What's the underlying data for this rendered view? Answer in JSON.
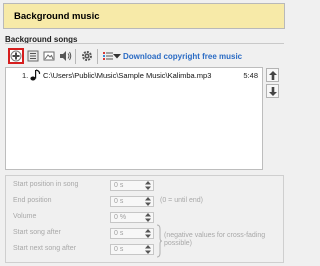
{
  "panel": {
    "title": "Background music"
  },
  "section": {
    "label": "Background songs"
  },
  "toolbar": {
    "buttons": [
      {
        "name": "add-song-button",
        "icon": "plus-icon"
      },
      {
        "name": "list-view-button",
        "icon": "list-icon"
      },
      {
        "name": "image-button",
        "icon": "image-icon"
      },
      {
        "name": "volume-button",
        "icon": "speaker-icon"
      },
      {
        "name": "settings-button",
        "icon": "gear-icon"
      },
      {
        "name": "list-options-button",
        "icon": "list-color-icon"
      },
      {
        "name": "dropdown-button",
        "icon": "chevron-down-icon"
      }
    ],
    "link_text": "Download copyright free music"
  },
  "songs": [
    {
      "index": "1.",
      "path": "C:\\Users\\Public\\Music\\Sample Music\\Kalimba.mp3",
      "duration": "5:48"
    }
  ],
  "properties": {
    "start_position": {
      "label": "Start position in song",
      "value": "0 s"
    },
    "end_position": {
      "label": "End position",
      "value": "0 s",
      "note": "(0 = until end)"
    },
    "volume": {
      "label": "Volume",
      "value": "0 %"
    },
    "start_song_after": {
      "label": "Start song after",
      "value": "0 s"
    },
    "start_next_song_after": {
      "label": "Start next song after",
      "value": "0 s"
    },
    "cross_fading_note_line1": "(negative values for cross-fading",
    "cross_fading_note_line2": "possible)"
  },
  "colors": {
    "title_bg": "#f7eaa8",
    "link": "#2a6bc4",
    "highlight": "#d61e1e"
  }
}
